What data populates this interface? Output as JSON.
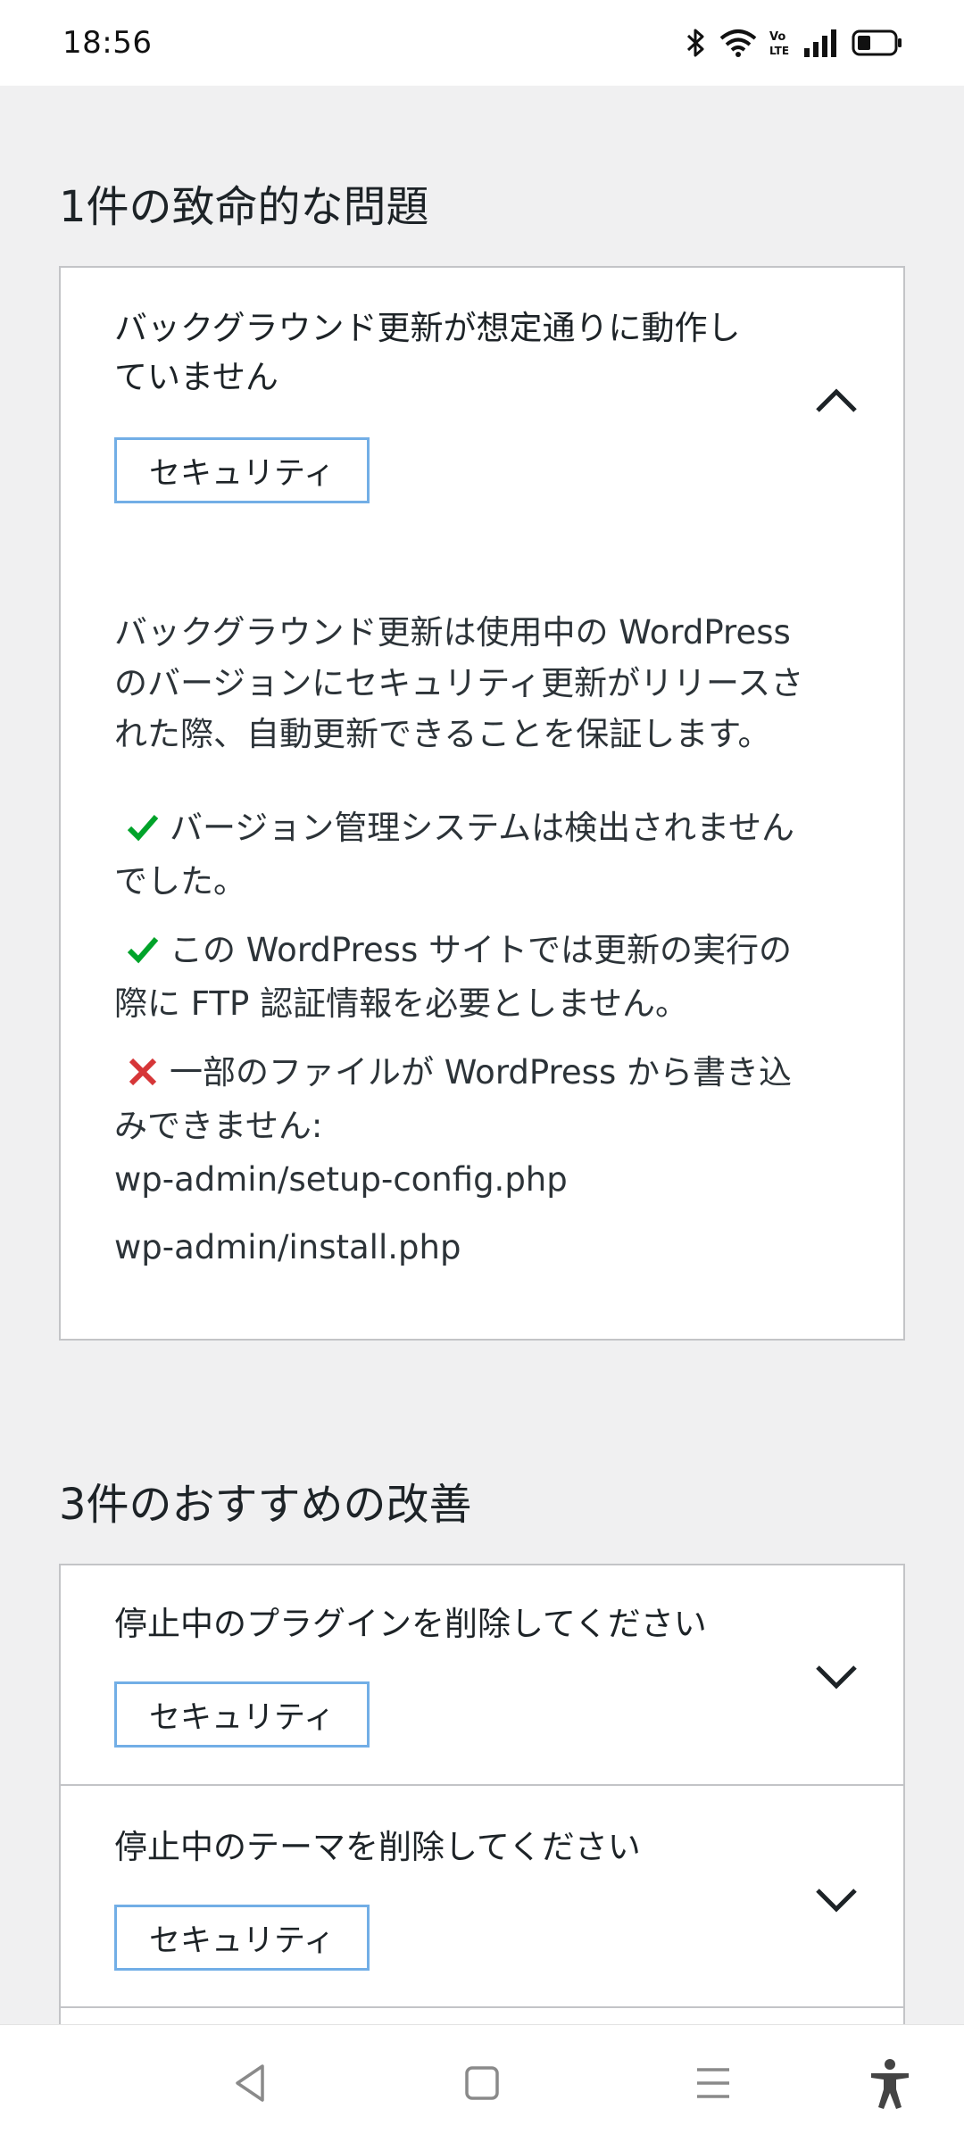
{
  "status_bar": {
    "time": "18:56"
  },
  "critical": {
    "heading": "1件の致命的な問題",
    "item": {
      "title_line1": "バックグラウンド更新が想定通りに動作し",
      "title_line2": "ていません",
      "badge": "セキュリティ",
      "description_line1": "バックグラウンド更新は使用中の WordPress",
      "description_line2": "のバージョンにセキュリティ更新がリリースさ",
      "description_line3": "れた際、自動更新できることを保証します。",
      "checks": [
        {
          "status": "pass",
          "line1": "バージョン管理システムは検出されません",
          "line2": "でした。"
        },
        {
          "status": "pass",
          "line1": "この WordPress サイトでは更新の実行の",
          "line2": "際に FTP 認証情報を必要としません。"
        },
        {
          "status": "fail",
          "line1": "一部のファイルが WordPress から書き込",
          "line2": "みできません:"
        }
      ],
      "files": [
        "wp-admin/setup-config.php",
        "wp-admin/install.php"
      ]
    }
  },
  "recommended": {
    "heading": "3件のおすすめの改善",
    "items": [
      {
        "title": "停止中のプラグインを削除してください",
        "badge": "セキュリティ"
      },
      {
        "title": "停止中のテーマを削除してください",
        "badge": "セキュリティ"
      }
    ]
  },
  "colors": {
    "pass": "#00a32a",
    "fail": "#d63638",
    "badge_border": "#72aee6"
  },
  "icons": [
    "bluetooth-icon",
    "wifi-icon",
    "volte-icon",
    "signal-icon",
    "battery-icon",
    "chevron-up-icon",
    "chevron-down-icon",
    "check-icon",
    "cross-icon",
    "back-icon",
    "home-icon",
    "menu-icon",
    "accessibility-icon"
  ]
}
